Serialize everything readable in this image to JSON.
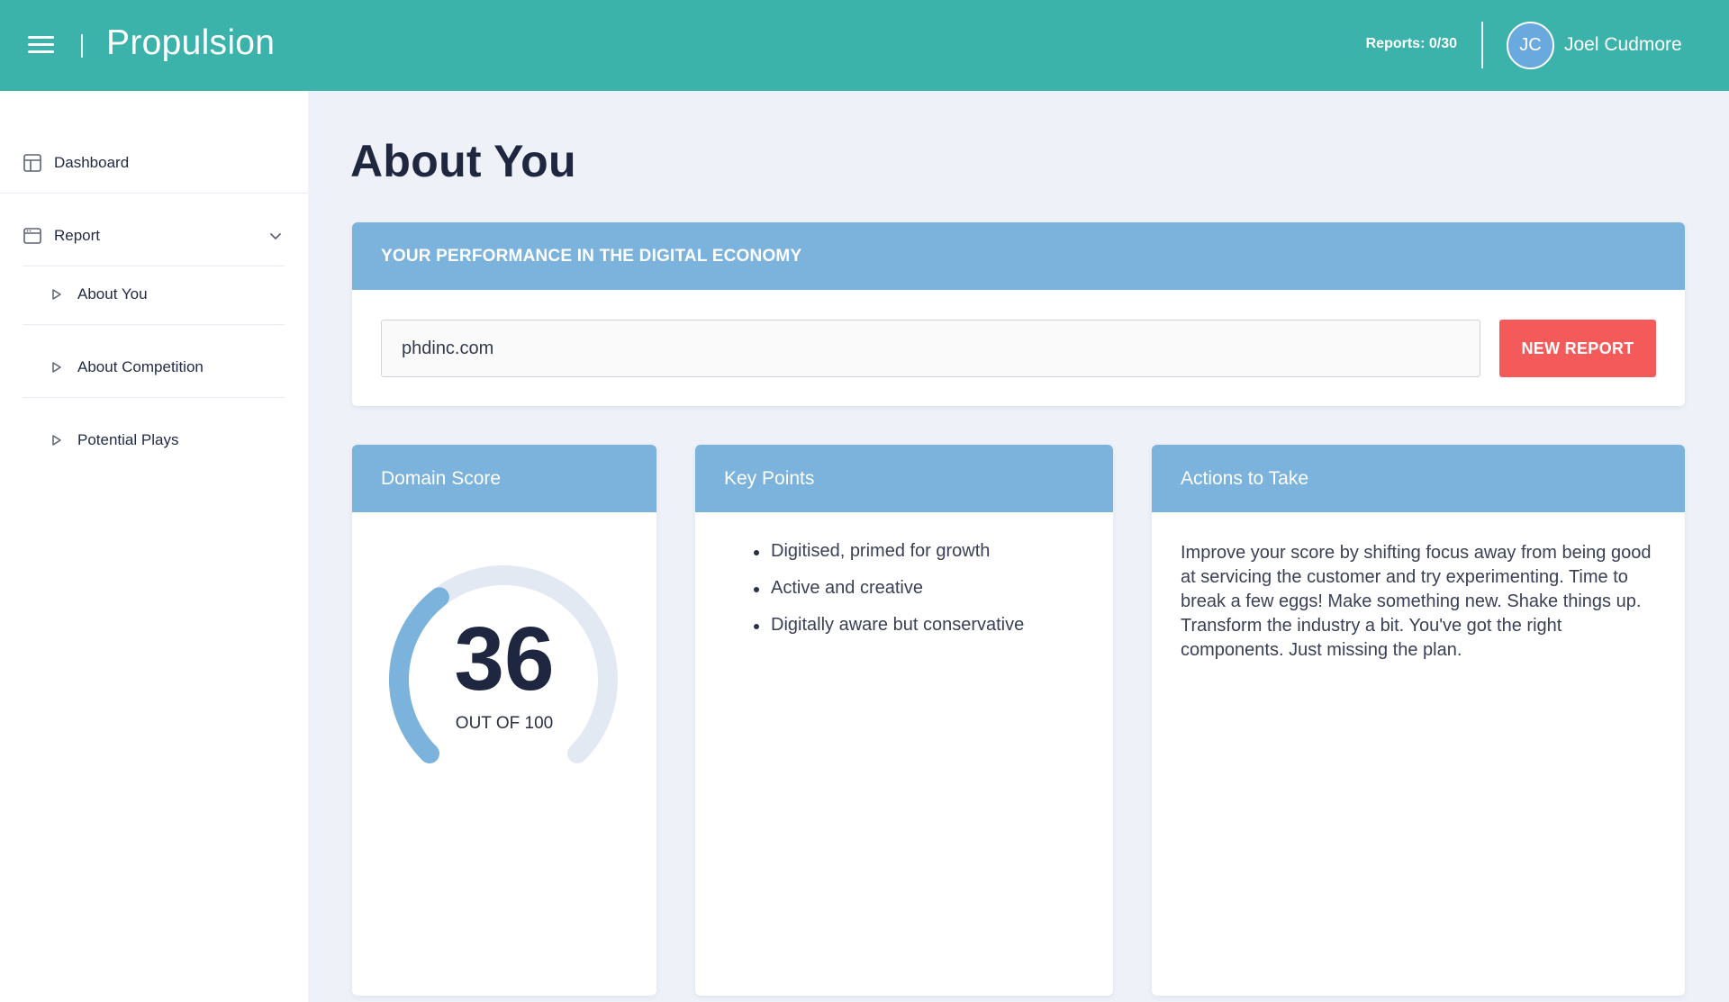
{
  "colors": {
    "brand": "#3bb3ab",
    "accent": "#7bb3dc",
    "danger": "#f45a5a",
    "gauge_track": "#e3e9f2"
  },
  "header": {
    "menu_icon": "hamburger-icon",
    "brand_title": "Propulsion",
    "reports_count": "Reports: 0/30",
    "user_initials": "JC",
    "user_name": "Joel Cudmore"
  },
  "sidebar": {
    "items": [
      {
        "label": "Dashboard",
        "icon": "dashboard-icon"
      },
      {
        "label": "Report",
        "icon": "report-icon"
      }
    ],
    "sub_items": [
      {
        "label": "About You",
        "icon": "triangle-right-icon"
      },
      {
        "label": "About Competition",
        "icon": "triangle-right-icon"
      },
      {
        "label": "Potential Plays",
        "icon": "triangle-right-icon"
      }
    ]
  },
  "main": {
    "page_title": "About You",
    "performance": {
      "heading": "YOUR PERFORMANCE IN THE DIGITAL ECONOMY",
      "domain_value": "phdinc.com",
      "button_label": "NEW REPORT"
    },
    "domain_score": {
      "heading": "Domain Score",
      "score": 36,
      "score_display": "36",
      "max": 100,
      "caption": "OUT OF 100"
    },
    "key_points": {
      "heading": "Key Points",
      "items": [
        "Digitised, primed for growth",
        "Active and creative",
        "Digitally aware but conservative"
      ]
    },
    "actions": {
      "heading": "Actions to Take",
      "text": "Improve your score by shifting focus away from being good at servicing the customer and try experimenting. Time to break a few eggs! Make something new. Shake things up. Transform the industry a bit. You've got the right components. Just missing the plan."
    }
  }
}
